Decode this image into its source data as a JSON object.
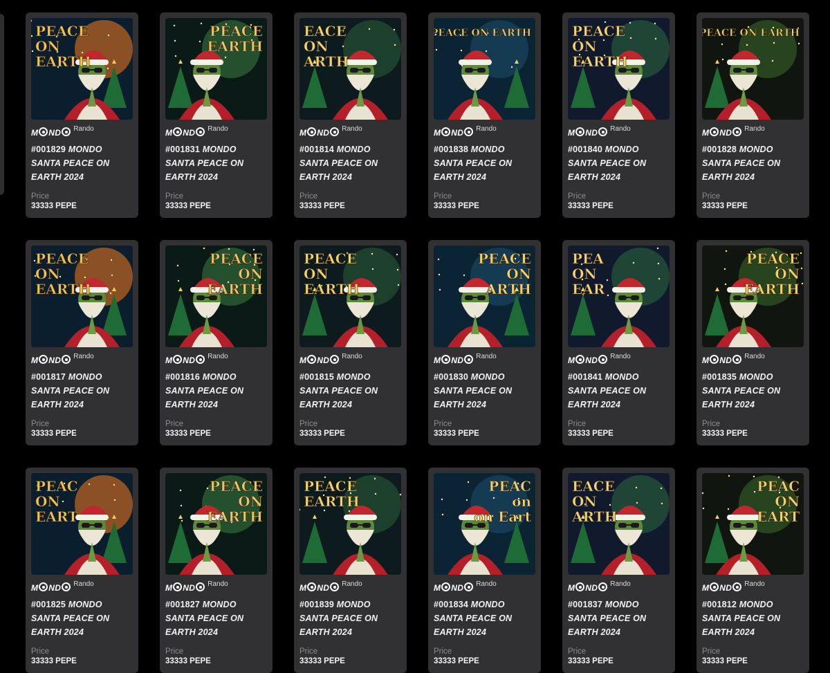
{
  "brand": {
    "logo_text": "MONDO",
    "sub_label": "Rando"
  },
  "price_label": "Price",
  "colors": {
    "background": "#000000",
    "card": "#313133",
    "muted": "#8d8d8f",
    "text": "#f2f2f2"
  },
  "cards": [
    {
      "number": "#001829",
      "title": "MONDO SANTA PEACE ON EARTH 2024",
      "price": "33333 PEPE",
      "art_text": [
        "PEACE",
        "ON",
        "EARTH"
      ]
    },
    {
      "number": "#001831",
      "title": "MONDO SANTA PEACE ON EARTH 2024",
      "price": "33333 PEPE",
      "art_text": [
        "PEACE",
        "EARTH"
      ]
    },
    {
      "number": "#001814",
      "title": "MONDO SANTA PEACE ON EARTH 2024",
      "price": "33333 PEPE",
      "art_text": [
        "EACE",
        "ON",
        "ARTH"
      ]
    },
    {
      "number": "#001838",
      "title": "MONDO SANTA PEACE ON EARTH 2024",
      "price": "33333 PEPE",
      "art_text": [
        "PEACE ON EARTH"
      ]
    },
    {
      "number": "#001840",
      "title": "MONDO SANTA PEACE ON EARTH 2024",
      "price": "33333 PEPE",
      "art_text": [
        "PEACE",
        "ON",
        "EARTH"
      ]
    },
    {
      "number": "#001828",
      "title": "MONDO SANTA PEACE ON EARTH 2024",
      "price": "33333 PEPE",
      "art_text": [
        "PEACE ON EARTH"
      ]
    },
    {
      "number": "#001817",
      "title": "MONDO SANTA PEACE ON EARTH 2024",
      "price": "33333 PEPE",
      "art_text": [
        "PEACE",
        "ON",
        "EARTH"
      ]
    },
    {
      "number": "#001816",
      "title": "MONDO SANTA PEACE ON EARTH 2024",
      "price": "33333 PEPE",
      "art_text": [
        "PEACE",
        "ON",
        "EARTH"
      ]
    },
    {
      "number": "#001815",
      "title": "MONDO SANTA PEACE ON EARTH 2024",
      "price": "33333 PEPE",
      "art_text": [
        "PEACE",
        "ON",
        "EARTH"
      ]
    },
    {
      "number": "#001830",
      "title": "MONDO SANTA PEACE ON EARTH 2024",
      "price": "33333 PEPE",
      "art_text": [
        "PEACE",
        "ON",
        "ARTH"
      ]
    },
    {
      "number": "#001841",
      "title": "MONDO SANTA PEACE ON EARTH 2024",
      "price": "33333 PEPE",
      "art_text": [
        "PEA",
        "ON",
        "EAR"
      ]
    },
    {
      "number": "#001835",
      "title": "MONDO SANTA PEACE ON EARTH 2024",
      "price": "33333 PEPE",
      "art_text": [
        "PEACE",
        "ON",
        "EARTH"
      ]
    },
    {
      "number": "#001825",
      "title": "MONDO SANTA PEACE ON EARTH 2024",
      "price": "33333 PEPE",
      "art_text": [
        "PEAC",
        "ON",
        "EART"
      ]
    },
    {
      "number": "#001827",
      "title": "MONDO SANTA PEACE ON EARTH 2024",
      "price": "33333 PEPE",
      "art_text": [
        "PEACE",
        "ON",
        "EARTH"
      ]
    },
    {
      "number": "#001839",
      "title": "MONDO SANTA PEACE ON EARTH 2024",
      "price": "33333 PEPE",
      "art_text": [
        "PEACE",
        "EARTH"
      ]
    },
    {
      "number": "#001834",
      "title": "MONDO SANTA PEACE ON EARTH 2024",
      "price": "33333 PEPE",
      "art_text": [
        "PEAC",
        "on",
        "on Eart"
      ]
    },
    {
      "number": "#001837",
      "title": "MONDO SANTA PEACE ON EARTH 2024",
      "price": "33333 PEPE",
      "art_text": [
        "EACE",
        "ON",
        "ARTH"
      ]
    },
    {
      "number": "#001812",
      "title": "MONDO SANTA PEACE ON EARTH 2024",
      "price": "33333 PEPE",
      "art_text": [
        "PEAC",
        "ON",
        "EART"
      ]
    }
  ]
}
